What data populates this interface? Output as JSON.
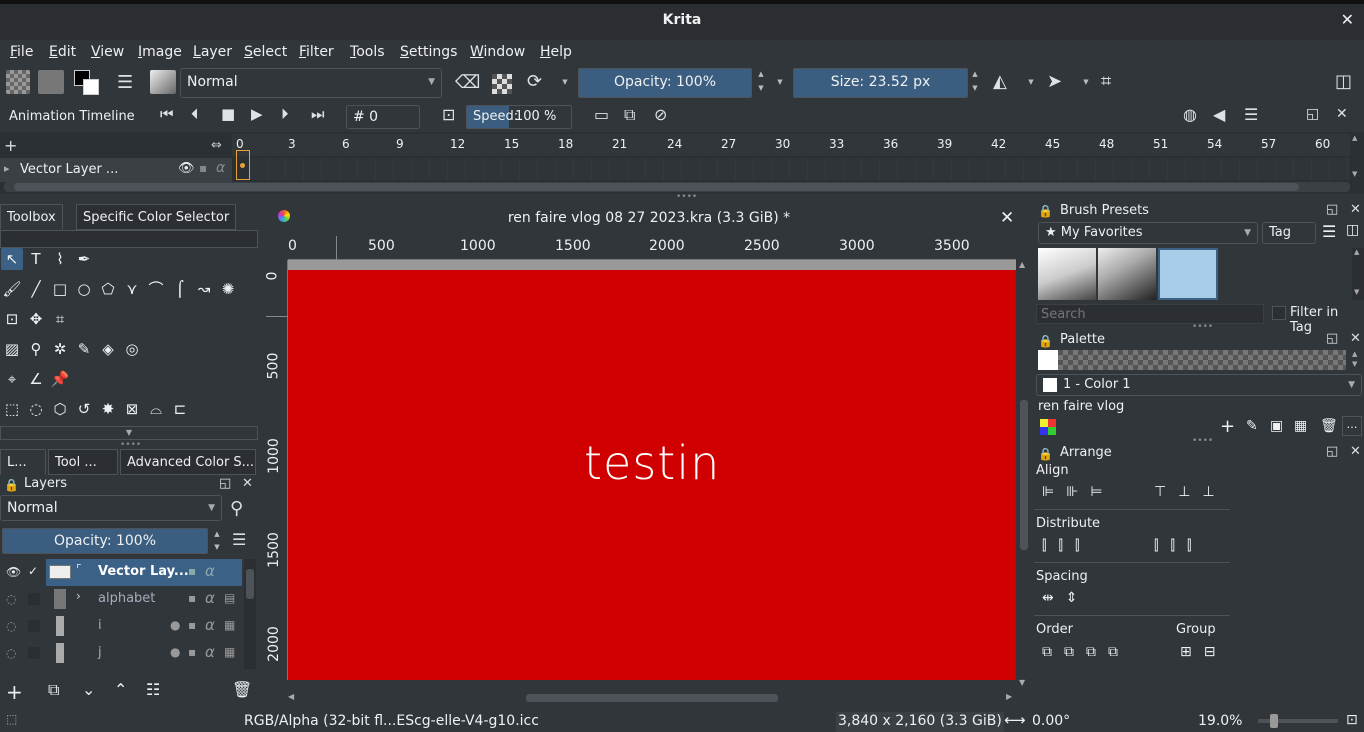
{
  "app": {
    "title": "Krita"
  },
  "menu": [
    "File",
    "Edit",
    "View",
    "Image",
    "Layer",
    "Select",
    "Filter",
    "Tools",
    "Settings",
    "Window",
    "Help"
  ],
  "toolbar": {
    "blend_mode": "Normal",
    "opacity": "Opacity: 100%",
    "size": "Size: 23.52 px"
  },
  "animation": {
    "label": "Animation Timeline",
    "frame": "# 0",
    "speed_label": "Speed:",
    "speed_value": "100 %",
    "ruler": [
      "0",
      "3",
      "6",
      "9",
      "12",
      "15",
      "18",
      "21",
      "24",
      "27",
      "30",
      "33",
      "36",
      "39",
      "42",
      "45",
      "48",
      "51",
      "54",
      "57",
      "60"
    ],
    "layer_name": "Vector Layer ..."
  },
  "left_dock": {
    "tabs": [
      "Toolbox",
      "Specific Color Selector"
    ],
    "bottom_tabs": [
      "L...",
      "Tool ...",
      "Advanced Color S..."
    ],
    "layers": {
      "title": "Layers",
      "blend": "Normal",
      "opacity": "Opacity:  100%",
      "rows": [
        {
          "name": "Vector Lay..."
        },
        {
          "name": "alphabet"
        },
        {
          "name": "i"
        },
        {
          "name": "j"
        }
      ]
    }
  },
  "canvas": {
    "doc_title": "ren faire vlog 08 27 2023.kra (3.3 GiB) *",
    "h_ruler": [
      "0",
      "500",
      "1000",
      "1500",
      "2000",
      "2500",
      "3000",
      "3500"
    ],
    "v_ruler": [
      "0",
      "500",
      "1000",
      "1500",
      "2000"
    ],
    "text": "testin",
    "bg_color": "#d10000"
  },
  "right_dock": {
    "brush_presets": {
      "title": "Brush Presets",
      "tag": "★ My Favorites",
      "tag_btn": "Tag",
      "search_placeholder": "Search",
      "filter": "Filter in Tag"
    },
    "palette": {
      "title": "Palette",
      "color_name": "1 - Color 1",
      "palette_name": "ren faire vlog"
    },
    "arrange": {
      "title": "Arrange",
      "align": "Align",
      "distribute": "Distribute",
      "spacing": "Spacing",
      "order": "Order",
      "group": "Group"
    }
  },
  "status": {
    "colorspace": "RGB/Alpha (32-bit fl...EScg-elle-V4-g10.icc",
    "dimensions": "3,840 x 2,160 (3.3 GiB)",
    "rotation": "0.00°",
    "zoom": "19.0%"
  }
}
